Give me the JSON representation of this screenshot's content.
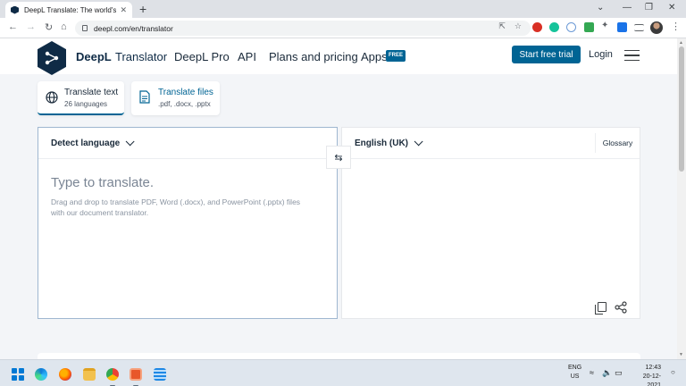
{
  "browser": {
    "tab_title": "DeepL Translate: The world's mos",
    "tab_close": "✕",
    "new_tab": "+",
    "url": "deepl.com/en/translator",
    "window_controls": [
      "⌄",
      "—",
      "❐",
      "✕"
    ]
  },
  "header": {
    "brand": "DeepL",
    "brand_sub": "Translator",
    "nav": [
      "DeepL Pro",
      "API",
      "Plans and pricing",
      "Apps"
    ],
    "apps_badge": "FREE",
    "cta": "Start free trial",
    "login": "Login"
  },
  "modes": [
    {
      "title": "Translate text",
      "subtitle": "26 languages"
    },
    {
      "title": "Translate files",
      "subtitle": ".pdf, .docx, .pptx"
    }
  ],
  "source": {
    "language": "Detect language",
    "placeholder": "Type to translate.",
    "hint": "Drag and drop to translate PDF, Word (.docx), and PowerPoint (.pptx) files with our document translator."
  },
  "target": {
    "language": "English (UK)",
    "glossary": "Glossary"
  },
  "taskbar": {
    "lang_line1": "ENG",
    "lang_line2": "US",
    "time": "12:43",
    "date": "20-12-2021"
  },
  "colors": {
    "brand_navy": "#0f2b46",
    "accent_blue": "#006494"
  }
}
